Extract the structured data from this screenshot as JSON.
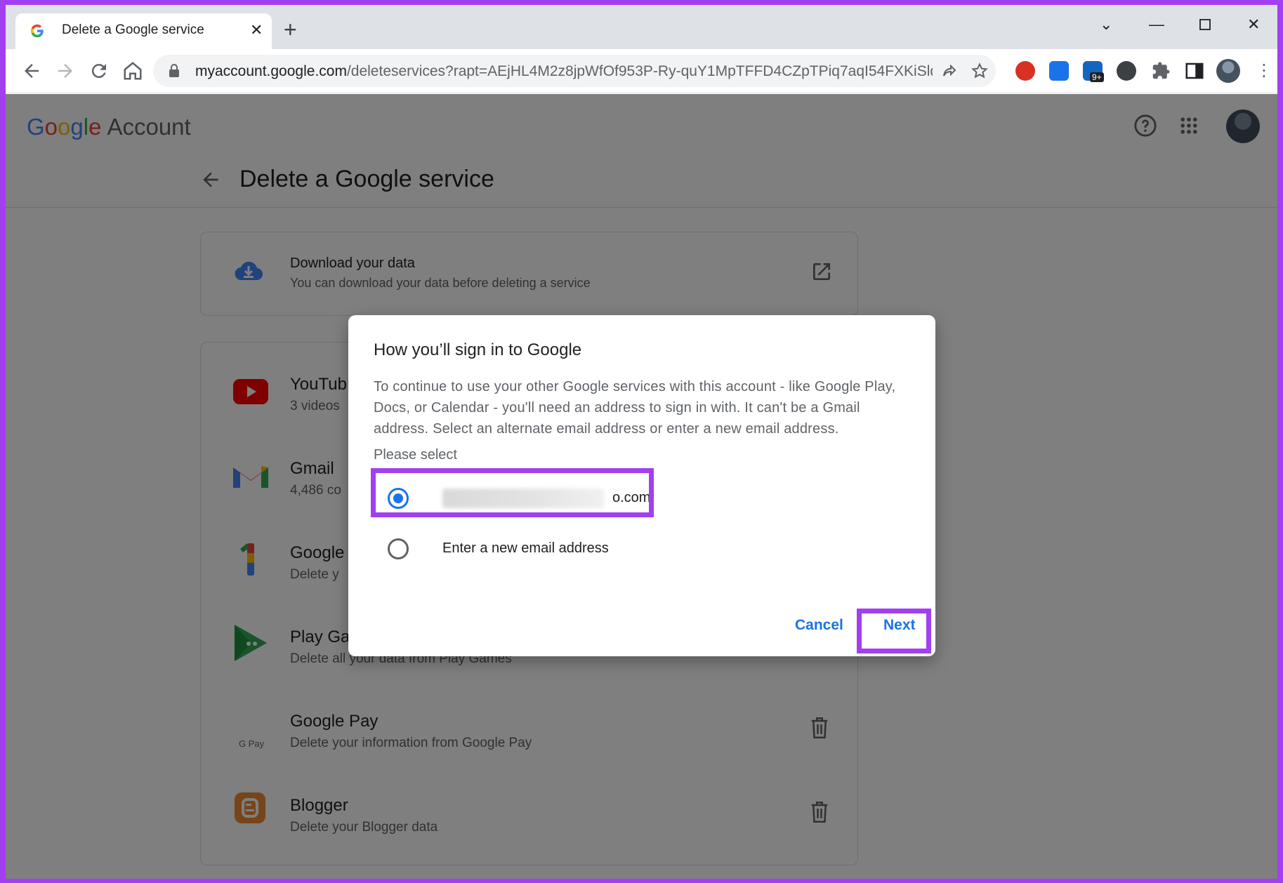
{
  "browser": {
    "tab_title": "Delete a Google service",
    "new_tab": "+",
    "url_host": "myaccount.google.com",
    "url_path": "/deleteservices?rapt=AEjHL4M2z8jpWfOf953P-Ry-quY1MpTFFD4CZpTPiq7aqI54FXKiSlq...",
    "extension_badge": "9+"
  },
  "header": {
    "logo_letters": [
      "G",
      "o",
      "o",
      "g",
      "l",
      "e"
    ],
    "logo_suffix": "Account"
  },
  "subheader": {
    "title": "Delete a Google service"
  },
  "download_card": {
    "title": "Download your data",
    "subtitle": "You can download your data before deleting a service"
  },
  "services": [
    {
      "title": "YouTub",
      "subtitle": "3 videos",
      "icon": "youtube-icon"
    },
    {
      "title": "Gmail",
      "subtitle": "4,486 co",
      "icon": "gmail-icon"
    },
    {
      "title": "Google",
      "subtitle": "Delete y",
      "icon": "google-one-icon"
    },
    {
      "title": "Play Ga",
      "subtitle": "Delete all your data from Play Games",
      "icon": "play-games-icon"
    },
    {
      "title": "Google Pay",
      "subtitle": "Delete your information from Google Pay",
      "icon": "google-pay-icon",
      "icon_text": "G Pay"
    },
    {
      "title": "Blogger",
      "subtitle": "Delete your Blogger data",
      "icon": "blogger-icon"
    }
  ],
  "dialog": {
    "title": "How you’ll sign in to Google",
    "body": "To continue to use your other Google services with this account - like Google Play, Docs, or Calendar - you'll need an address to sign in with. It can't be a Gmail address. Select an alternate email address or enter a new email address.",
    "label": "Please select",
    "option_1_visible": "o.com",
    "option_2": "Enter a new email address",
    "cancel": "Cancel",
    "next": "Next"
  },
  "colors": {
    "highlight": "#a23ff0",
    "accent": "#1a73e8"
  }
}
